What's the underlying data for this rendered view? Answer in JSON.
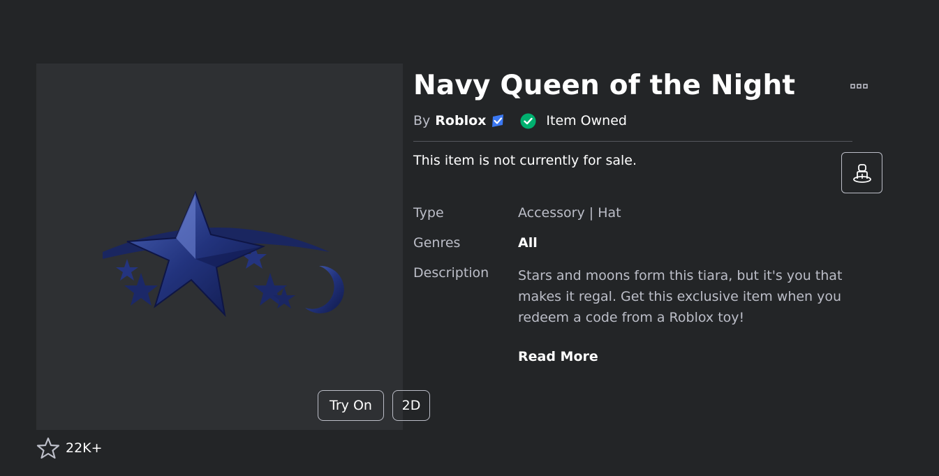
{
  "item": {
    "title": "Navy Queen of the Night",
    "by_label": "By",
    "creator": "Roblox",
    "owned_label": "Item Owned",
    "sale_status": "This item is not currently for sale.",
    "favorites_count": "22K+"
  },
  "thumbnail": {
    "try_on_label": "Try On",
    "view_2d_label": "2D"
  },
  "details": {
    "type_label": "Type",
    "type_value": "Accessory | Hat",
    "genres_label": "Genres",
    "genres_value": "All",
    "description_label": "Description",
    "description_lines": [
      "Stars and moons form this tiara, but it's you that",
      "makes it regal. Get this exclusive item when you",
      "redeem a code from a Roblox toy!"
    ],
    "read_more_label": "Read More"
  },
  "icons": {
    "more": "ellipsis-icon",
    "verified": "verified-badge-icon",
    "owned": "check-circle-icon",
    "avatar": "avatar-preview-icon",
    "favorite": "star-outline-icon"
  },
  "colors": {
    "background": "#232527",
    "panel": "#2e3033",
    "muted_text": "#bcbec8",
    "verified_blue": "#3b78f2",
    "owned_green": "#00b06f",
    "item_navy": "#1c2a6b"
  }
}
